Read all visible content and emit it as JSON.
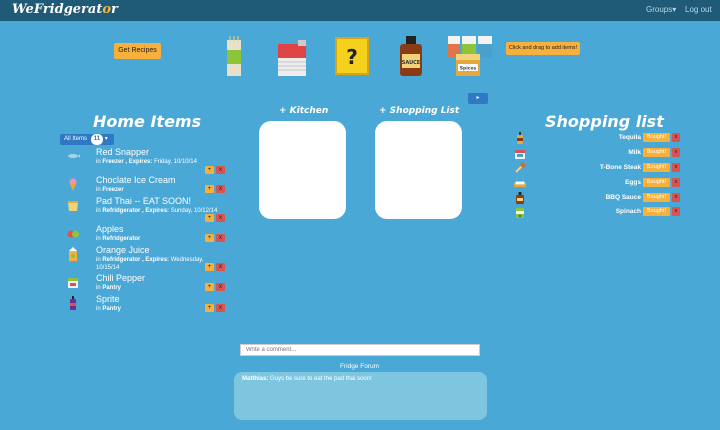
{
  "nav": {
    "brand_prefix": "We",
    "brand_main": "Fridgerat",
    "brand_dot": "o",
    "brand_suffix": "r",
    "groups": "Groups▾",
    "logout": "Log out"
  },
  "toolbar": {
    "get_recipes": "Get Recipes",
    "drag_hint": "Click and drag to add items!",
    "small_button": "▸"
  },
  "palette": [
    {
      "name": "spaghetti-icon",
      "label": ""
    },
    {
      "name": "soup-can-icon",
      "label": ""
    },
    {
      "name": "mystery-box-icon",
      "label": "?"
    },
    {
      "name": "sauce-bottle-icon",
      "label": "SAUCE"
    },
    {
      "name": "spice-jars-icon",
      "label": "Spices"
    }
  ],
  "home": {
    "title": "Home Items",
    "filter_label": "All Items",
    "filter_count": "11",
    "items": [
      {
        "name": "Red Snapper",
        "in": "in",
        "location": "Freezer",
        "sep": ", Expires:",
        "expires": "Friday, 10/10/14",
        "icon": "fish-icon"
      },
      {
        "name": "Choclate Ice Cream",
        "in": "in",
        "location": "Freezer",
        "sep": "",
        "expires": "",
        "icon": "ice-cream-icon"
      },
      {
        "name": "Pad Thai -- EAT SOON!",
        "in": "in",
        "location": "Refridgerator",
        "sep": ", Expires:",
        "expires": "Sunday, 10/12/14",
        "icon": "takeout-box-icon"
      },
      {
        "name": "Apples",
        "in": "in",
        "location": "Refridgerator",
        "sep": "",
        "expires": "",
        "icon": "apples-icon"
      },
      {
        "name": "Orange Juice",
        "in": "in",
        "location": "Refridgerator",
        "sep": ", Expires:",
        "expires": "Wednesday, 10/15/14",
        "icon": "juice-carton-icon"
      },
      {
        "name": "Chili Pepper",
        "in": "in",
        "location": "Pantry",
        "sep": "",
        "expires": "",
        "icon": "chili-pepper-icon"
      },
      {
        "name": "Sprite",
        "in": "in",
        "location": "Pantry",
        "sep": "",
        "expires": "",
        "icon": "soda-bottle-icon"
      }
    ],
    "plus": "+",
    "x": "x"
  },
  "boxes": {
    "kitchen_title": "+ Kitchen",
    "shopping_title": "+ Shopping List"
  },
  "shopping": {
    "title": "Shopping list",
    "bought_label": "Bought!",
    "x": "x",
    "items": [
      {
        "name": "Tequila",
        "icon": "tequila-bottle-icon"
      },
      {
        "name": "Milk",
        "icon": "milk-carton-icon"
      },
      {
        "name": "T-Bone Steak",
        "icon": "steak-icon"
      },
      {
        "name": "Eggs",
        "icon": "eggs-icon"
      },
      {
        "name": "BBQ Sauce",
        "icon": "bbq-sauce-icon"
      },
      {
        "name": "Spinach",
        "icon": "spinach-icon"
      }
    ]
  },
  "forum": {
    "placeholder": "Write a comment...",
    "title": "Fridge Forum",
    "messages": [
      {
        "author": "Matthias:",
        "text": "Guys be sure to eat the pad thai soon!"
      }
    ]
  },
  "colors": {
    "background": "#4aa8d6",
    "navbar": "#1f5a76",
    "accent_orange": "#f6b03b",
    "delete_red": "#d9534f",
    "filter_blue": "#2e78c4"
  }
}
